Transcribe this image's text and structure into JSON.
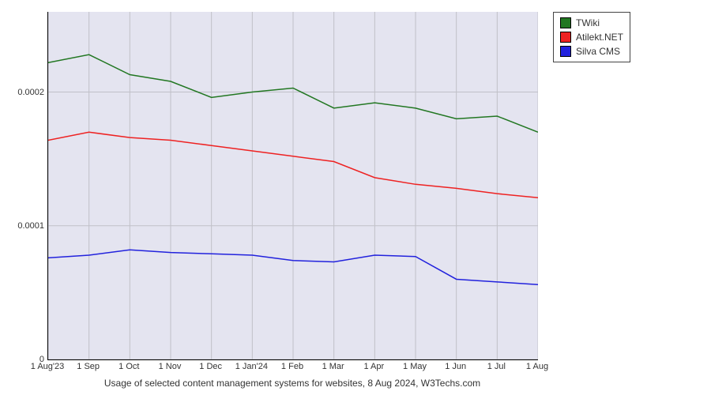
{
  "chart_data": {
    "type": "line",
    "title": "Usage of selected content management systems for websites, 8 Aug 2024, W3Techs.com",
    "xlabel": "",
    "ylabel": "",
    "ylim": [
      0,
      0.00026
    ],
    "yticks": [
      0,
      0.0001,
      0.0002
    ],
    "categories": [
      "1 Aug'23",
      "1 Sep",
      "1 Oct",
      "1 Nov",
      "1 Dec",
      "1 Jan'24",
      "1 Feb",
      "1 Mar",
      "1 Apr",
      "1 May",
      "1 Jun",
      "1 Jul",
      "1 Aug"
    ],
    "series": [
      {
        "name": "TWiki",
        "color": "#227722",
        "values": [
          0.000222,
          0.000228,
          0.000213,
          0.000208,
          0.000196,
          0.0002,
          0.000203,
          0.000188,
          0.000192,
          0.000188,
          0.00018,
          0.000182,
          0.00017
        ]
      },
      {
        "name": "Atilekt.NET",
        "color": "#ee2222",
        "values": [
          0.000164,
          0.00017,
          0.000166,
          0.000164,
          0.00016,
          0.000156,
          0.000152,
          0.000148,
          0.000136,
          0.000131,
          0.000128,
          0.000124,
          0.000121
        ]
      },
      {
        "name": "Silva CMS",
        "color": "#2222dd",
        "values": [
          7.6e-05,
          7.8e-05,
          8.2e-05,
          8e-05,
          7.9e-05,
          7.8e-05,
          7.4e-05,
          7.3e-05,
          7.8e-05,
          7.7e-05,
          6e-05,
          5.8e-05,
          5.6e-05
        ]
      }
    ]
  }
}
